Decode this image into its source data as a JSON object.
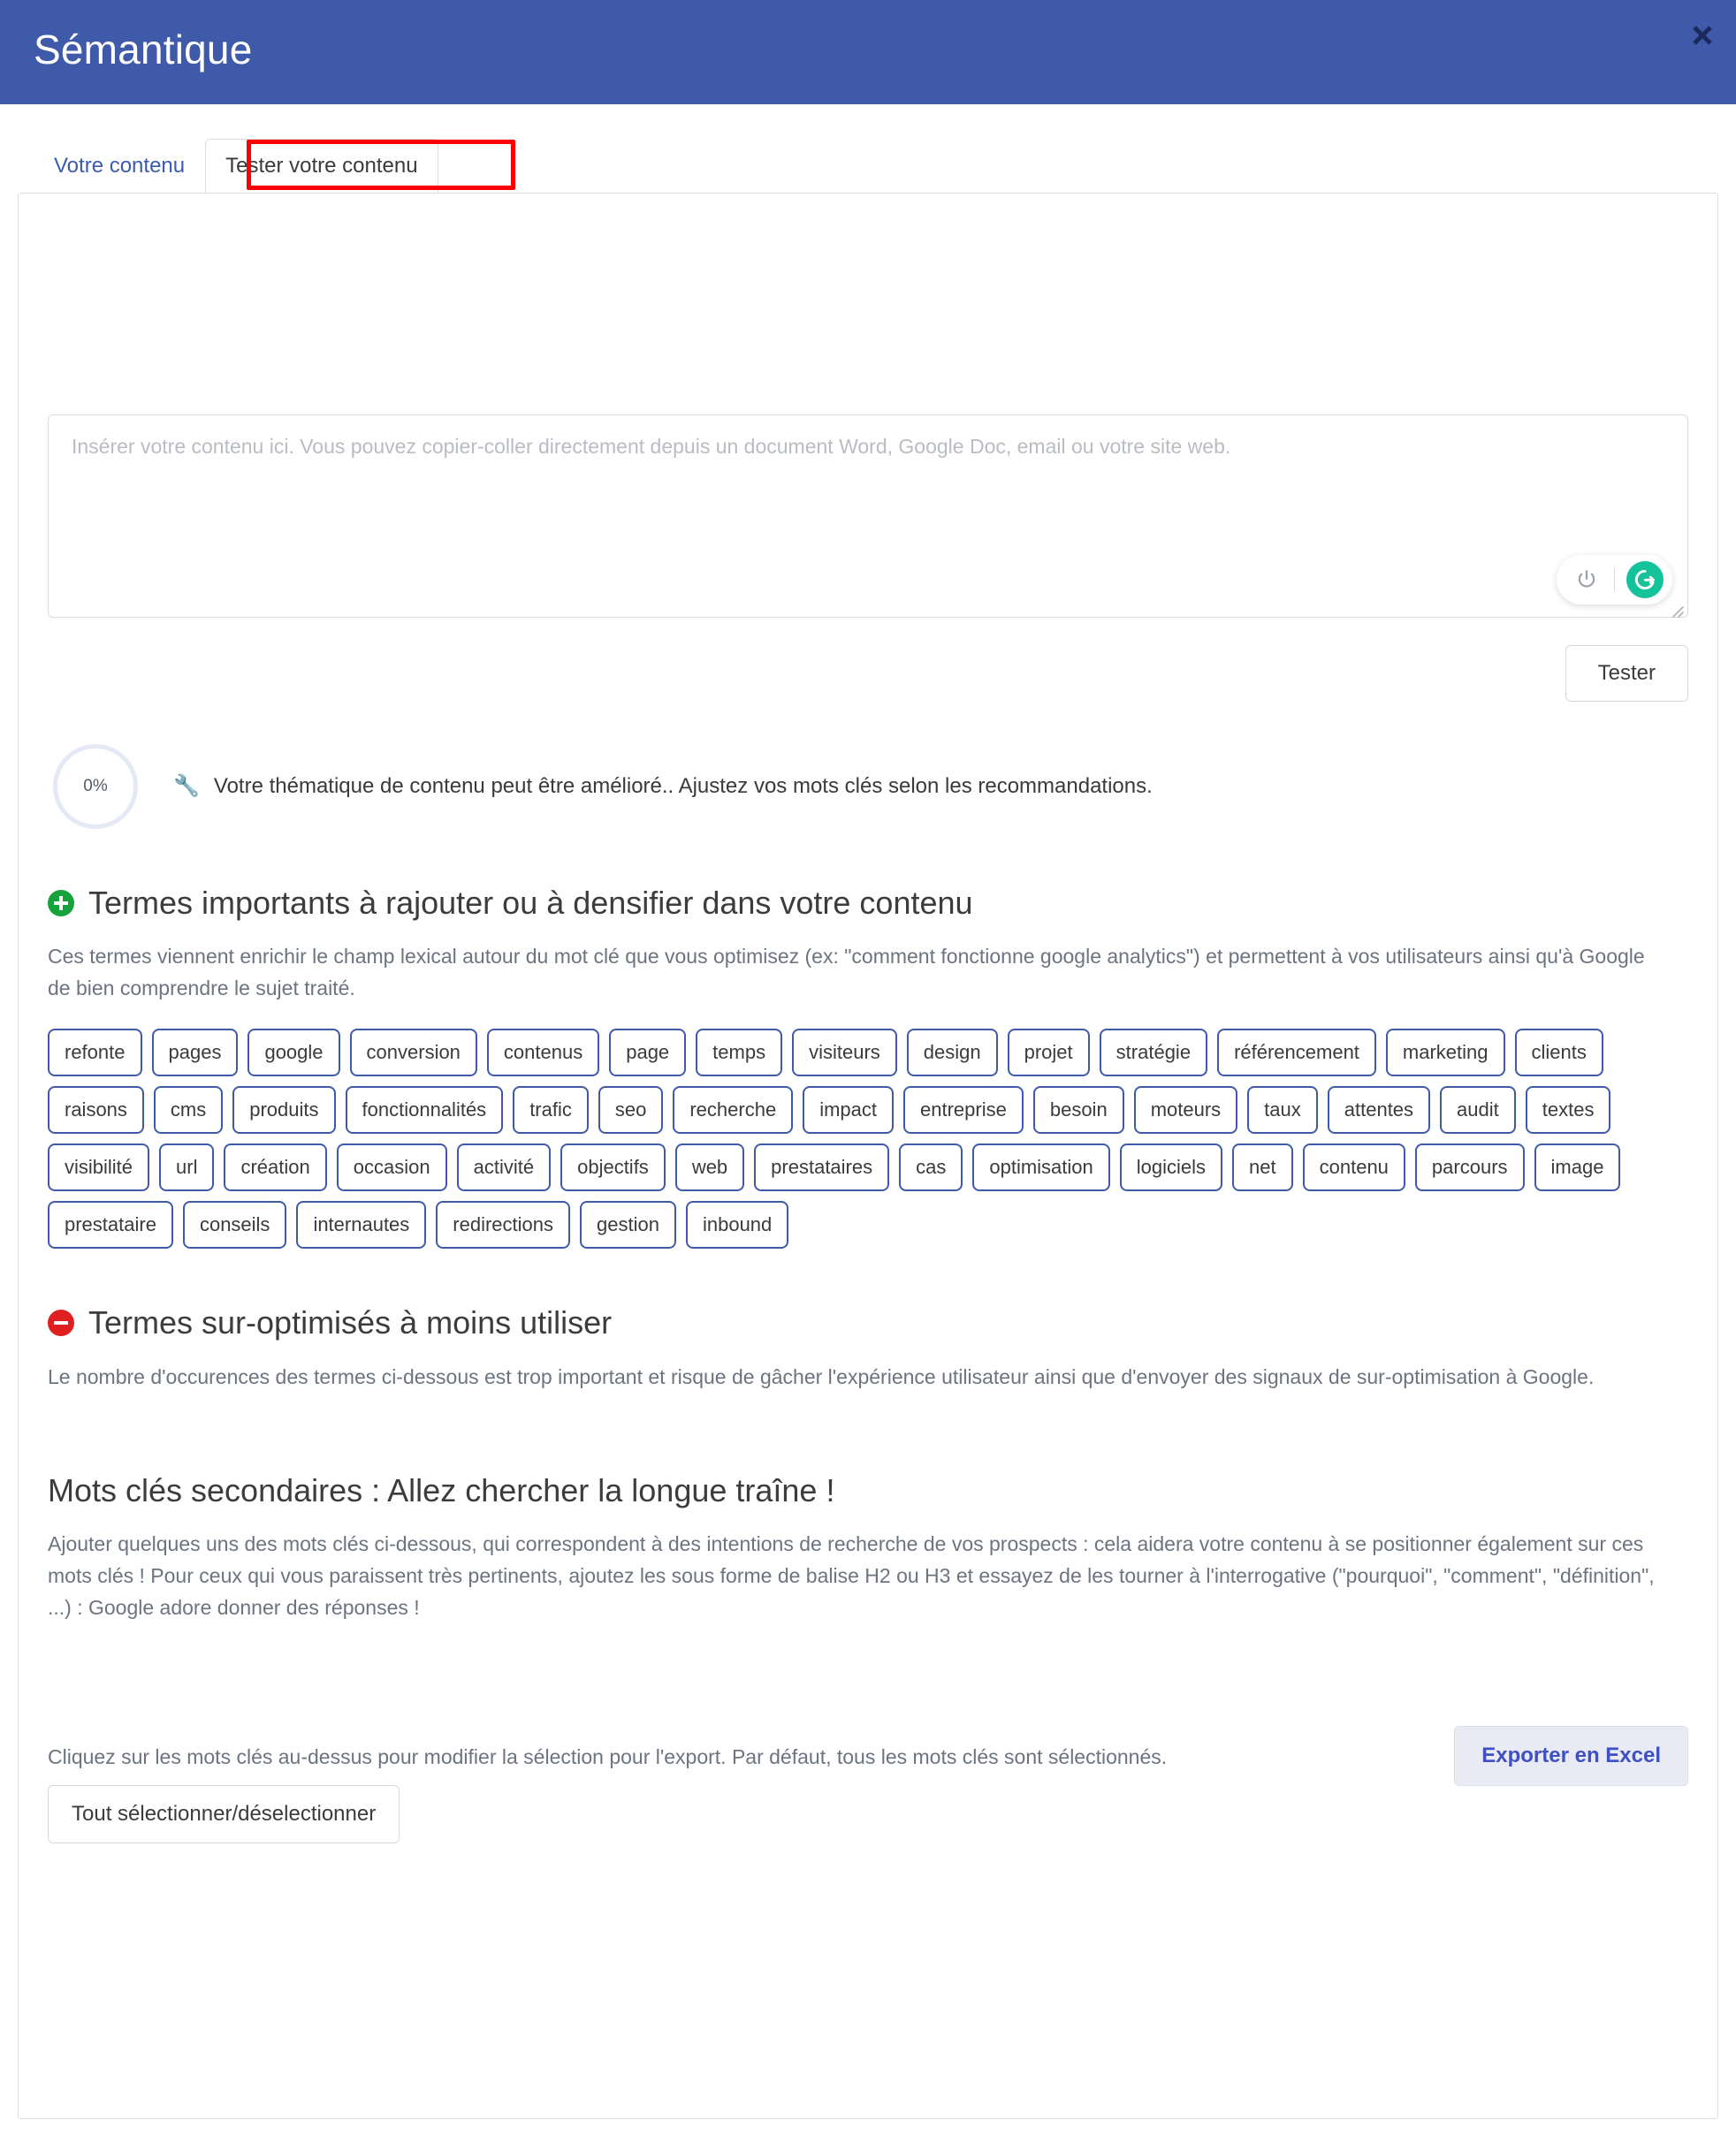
{
  "header": {
    "title": "Sémantique",
    "close_label": "×",
    "accent_color": "#3f5aa9"
  },
  "tabs": [
    {
      "label": "Votre contenu",
      "active": false
    },
    {
      "label": "Tester votre contenu",
      "active": true,
      "highlight_color": "#ff0000"
    }
  ],
  "editor": {
    "placeholder": "Insérer votre contenu ici. Vous pouvez copier-coller directement depuis un document Word, Google Doc, email ou votre site web.",
    "value": "",
    "grammarly": {
      "power_icon": "power-icon",
      "logo_icon": "grammarly-logo-icon",
      "logo_color": "#15c39a"
    },
    "test_button": "Tester"
  },
  "score": {
    "value": "0%",
    "icon": "wrench-icon",
    "message": "Votre thématique de contenu peut être amélioré.. Ajustez vos mots clés selon les recommandations.",
    "ring_color": "#e4e9f5"
  },
  "add_terms": {
    "badge_icon": "plus-circle-icon",
    "badge_color": "#16a33c",
    "title": "Termes importants à rajouter ou à densifier dans votre contenu",
    "description": "Ces termes viennent enrichir le champ lexical autour du mot clé que vous optimisez (ex: \"comment fonctionne google analytics\") et permettent à vos utilisateurs ainsi qu'à Google de bien comprendre le sujet traité.",
    "tags": [
      "refonte",
      "pages",
      "google",
      "conversion",
      "contenus",
      "page",
      "temps",
      "visiteurs",
      "design",
      "projet",
      "stratégie",
      "référencement",
      "marketing",
      "clients",
      "raisons",
      "cms",
      "produits",
      "fonctionnalités",
      "trafic",
      "seo",
      "recherche",
      "impact",
      "entreprise",
      "besoin",
      "moteurs",
      "taux",
      "attentes",
      "audit",
      "textes",
      "visibilité",
      "url",
      "création",
      "occasion",
      "activité",
      "objectifs",
      "web",
      "prestataires",
      "cas",
      "optimisation",
      "logiciels",
      "net",
      "contenu",
      "parcours",
      "image",
      "prestataire",
      "conseils",
      "internautes",
      "redirections",
      "gestion",
      "inbound"
    ]
  },
  "over_terms": {
    "badge_icon": "minus-circle-icon",
    "badge_color": "#e02020",
    "title": "Termes sur-optimisés à moins utiliser",
    "description": "Le nombre d'occurences des termes ci-dessous est trop important et risque de gâcher l'expérience utilisateur ainsi que d'envoyer des signaux de sur-optimisation à Google.",
    "tags": []
  },
  "long_tail": {
    "title": "Mots clés secondaires : Allez chercher la longue traîne !",
    "description": "Ajouter quelques uns des mots clés ci-dessous, qui correspondent à des intentions de recherche de vos prospects : cela aidera votre contenu à se positionner également sur ces mots clés ! Pour ceux qui vous paraissent très pertinents, ajoutez les sous forme de balise H2 ou H3 et essayez de les tourner à l'interrogative (\"pourquoi\", \"comment\", \"définition\", ...) : Google adore donner des réponses !",
    "tags": []
  },
  "footer": {
    "note": "Cliquez sur les mots clés au-dessus pour modifier la sélection pour l'export. Par défaut, tous les mots clés sont sélectionnés.",
    "select_all_label": "Tout sélectionner/déselectionner",
    "export_label": "Exporter en Excel",
    "export_color": "#3f4fc4"
  }
}
